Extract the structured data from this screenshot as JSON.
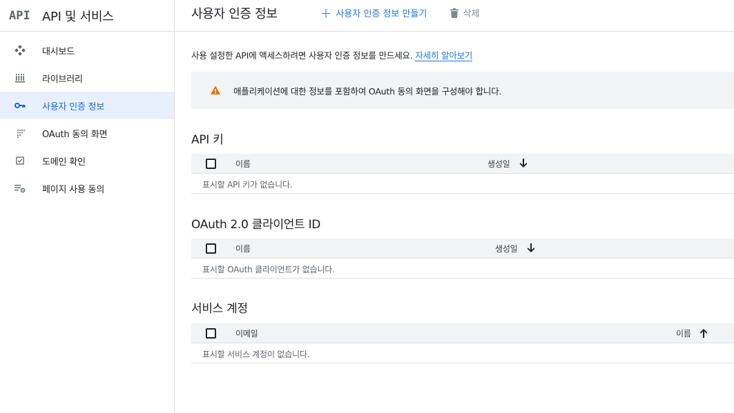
{
  "sidebar": {
    "logo_text": "API",
    "title": "API 및 서비스",
    "items": [
      {
        "label": "대시보드",
        "icon": "dashboard-icon",
        "active": false
      },
      {
        "label": "라이브러리",
        "icon": "library-icon",
        "active": false
      },
      {
        "label": "사용자 인증 정보",
        "icon": "key-icon",
        "active": true
      },
      {
        "label": "OAuth 동의 화면",
        "icon": "oauth-consent-icon",
        "active": false
      },
      {
        "label": "도메인 확인",
        "icon": "domain-check-icon",
        "active": false
      },
      {
        "label": "페이지 사용 동의",
        "icon": "page-consent-icon",
        "active": false
      }
    ]
  },
  "header": {
    "title": "사용자 인증 정보",
    "create_label": "사용자 인증 정보 만들기",
    "delete_label": "삭제"
  },
  "intro": {
    "text": "사용 설정한 API에 액세스하려면 사용자 인증 정보를 만드세요.",
    "link": "자세히 알아보기"
  },
  "banner": {
    "text": "애플리케이션에 대한 정보를 포함하여 OAuth 동의 화면을 구성해야 합니다."
  },
  "sections": {
    "api_keys": {
      "title": "API 키",
      "col_name": "이름",
      "col_created": "생성일",
      "empty": "표시할 API 키가 없습니다."
    },
    "oauth": {
      "title": "OAuth 2.0 클라이언트 ID",
      "col_name": "이름",
      "col_created": "생성일",
      "empty": "표시할 OAuth 클라이언트가 없습니다."
    },
    "service": {
      "title": "서비스 계정",
      "col_email": "이메일",
      "col_name": "이름",
      "empty": "표시할 서비스 계정이 없습니다."
    }
  },
  "colors": {
    "accent": "#1a73e8",
    "active_bg": "#e8f0fe",
    "warning": "#e37400"
  }
}
